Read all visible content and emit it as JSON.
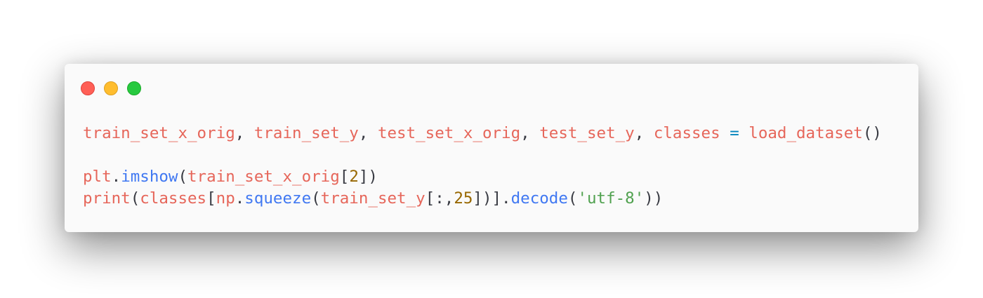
{
  "window": {
    "controls": [
      {
        "name": "close",
        "color": "#ff5f56",
        "border": "#e0443e"
      },
      {
        "name": "minimize",
        "color": "#ffbd2e",
        "border": "#dea123"
      },
      {
        "name": "zoom",
        "color": "#27c93f",
        "border": "#1aab29"
      }
    ]
  },
  "code": {
    "lines": [
      [
        {
          "t": "train_set_x_orig",
          "k": "var"
        },
        {
          "t": ", ",
          "k": "punc"
        },
        {
          "t": "train_set_y",
          "k": "var"
        },
        {
          "t": ", ",
          "k": "punc"
        },
        {
          "t": "test_set_x_orig",
          "k": "var"
        },
        {
          "t": ", ",
          "k": "punc"
        },
        {
          "t": "test_set_y",
          "k": "var"
        },
        {
          "t": ", ",
          "k": "punc"
        },
        {
          "t": "classes",
          "k": "var"
        },
        {
          "t": " ",
          "k": "punc"
        },
        {
          "t": "=",
          "k": "op"
        },
        {
          "t": " ",
          "k": "punc"
        },
        {
          "t": "load_dataset",
          "k": "var"
        },
        {
          "t": "()",
          "k": "punc"
        }
      ],
      [],
      [
        {
          "t": "plt",
          "k": "var"
        },
        {
          "t": ".",
          "k": "punc"
        },
        {
          "t": "imshow",
          "k": "func"
        },
        {
          "t": "(",
          "k": "punc"
        },
        {
          "t": "train_set_x_orig",
          "k": "var"
        },
        {
          "t": "[",
          "k": "punc"
        },
        {
          "t": "2",
          "k": "num"
        },
        {
          "t": "])",
          "k": "punc"
        }
      ],
      [
        {
          "t": "print",
          "k": "var"
        },
        {
          "t": "(",
          "k": "punc"
        },
        {
          "t": "classes",
          "k": "var"
        },
        {
          "t": "[",
          "k": "punc"
        },
        {
          "t": "np",
          "k": "var"
        },
        {
          "t": ".",
          "k": "punc"
        },
        {
          "t": "squeeze",
          "k": "func"
        },
        {
          "t": "(",
          "k": "punc"
        },
        {
          "t": "train_set_y",
          "k": "var"
        },
        {
          "t": "[:,",
          "k": "punc"
        },
        {
          "t": "25",
          "k": "num"
        },
        {
          "t": "])].",
          "k": "punc"
        },
        {
          "t": "decode",
          "k": "func"
        },
        {
          "t": "(",
          "k": "punc"
        },
        {
          "t": "'utf-8'",
          "k": "str"
        },
        {
          "t": "))",
          "k": "punc"
        }
      ]
    ]
  }
}
